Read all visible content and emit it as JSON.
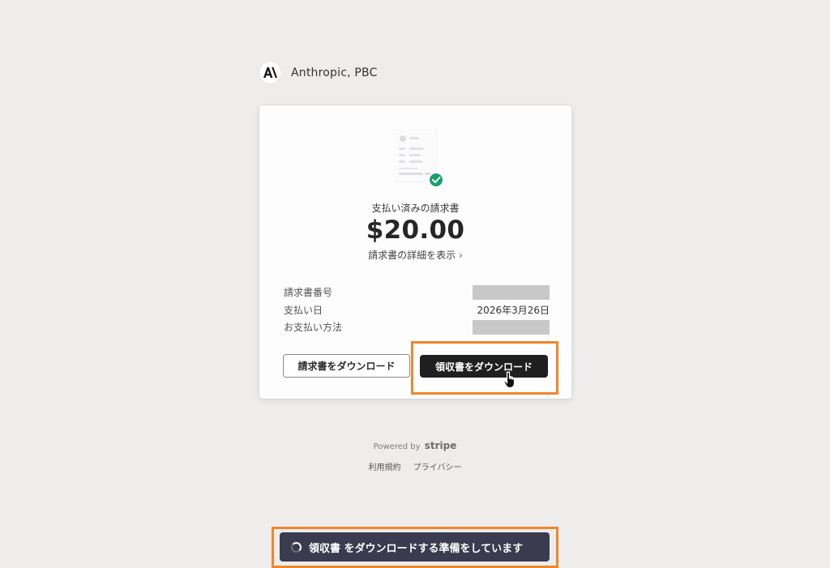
{
  "brand": {
    "name": "Anthropic, PBC",
    "logo_icon": "anthropic-logo-icon"
  },
  "invoice": {
    "status_label": "支払い済みの請求書",
    "amount": "$20.00",
    "detail_link": "請求書の詳細を表示",
    "rows": [
      {
        "label": "請求書番号",
        "value": "",
        "redacted": true
      },
      {
        "label": "支払い日",
        "value": "2026年3月26日",
        "redacted": false
      },
      {
        "label": "お支払い方法",
        "value": "",
        "redacted": true
      }
    ],
    "download_invoice_label": "請求書をダウンロード",
    "download_receipt_label": "領収書をダウンロード"
  },
  "footer": {
    "powered_by": "Powered by",
    "stripe": "stripe",
    "terms": "利用規約",
    "privacy": "プライバシー"
  },
  "toast": {
    "message": "領収書 をダウンロードする準備をしています"
  },
  "colors": {
    "background": "#eeedeb",
    "card": "#fdfdfe",
    "primary_button": "#1f1f1f",
    "toast": "#3a3b4f",
    "highlight": "#f0862b",
    "check": "#1a9e6a"
  }
}
